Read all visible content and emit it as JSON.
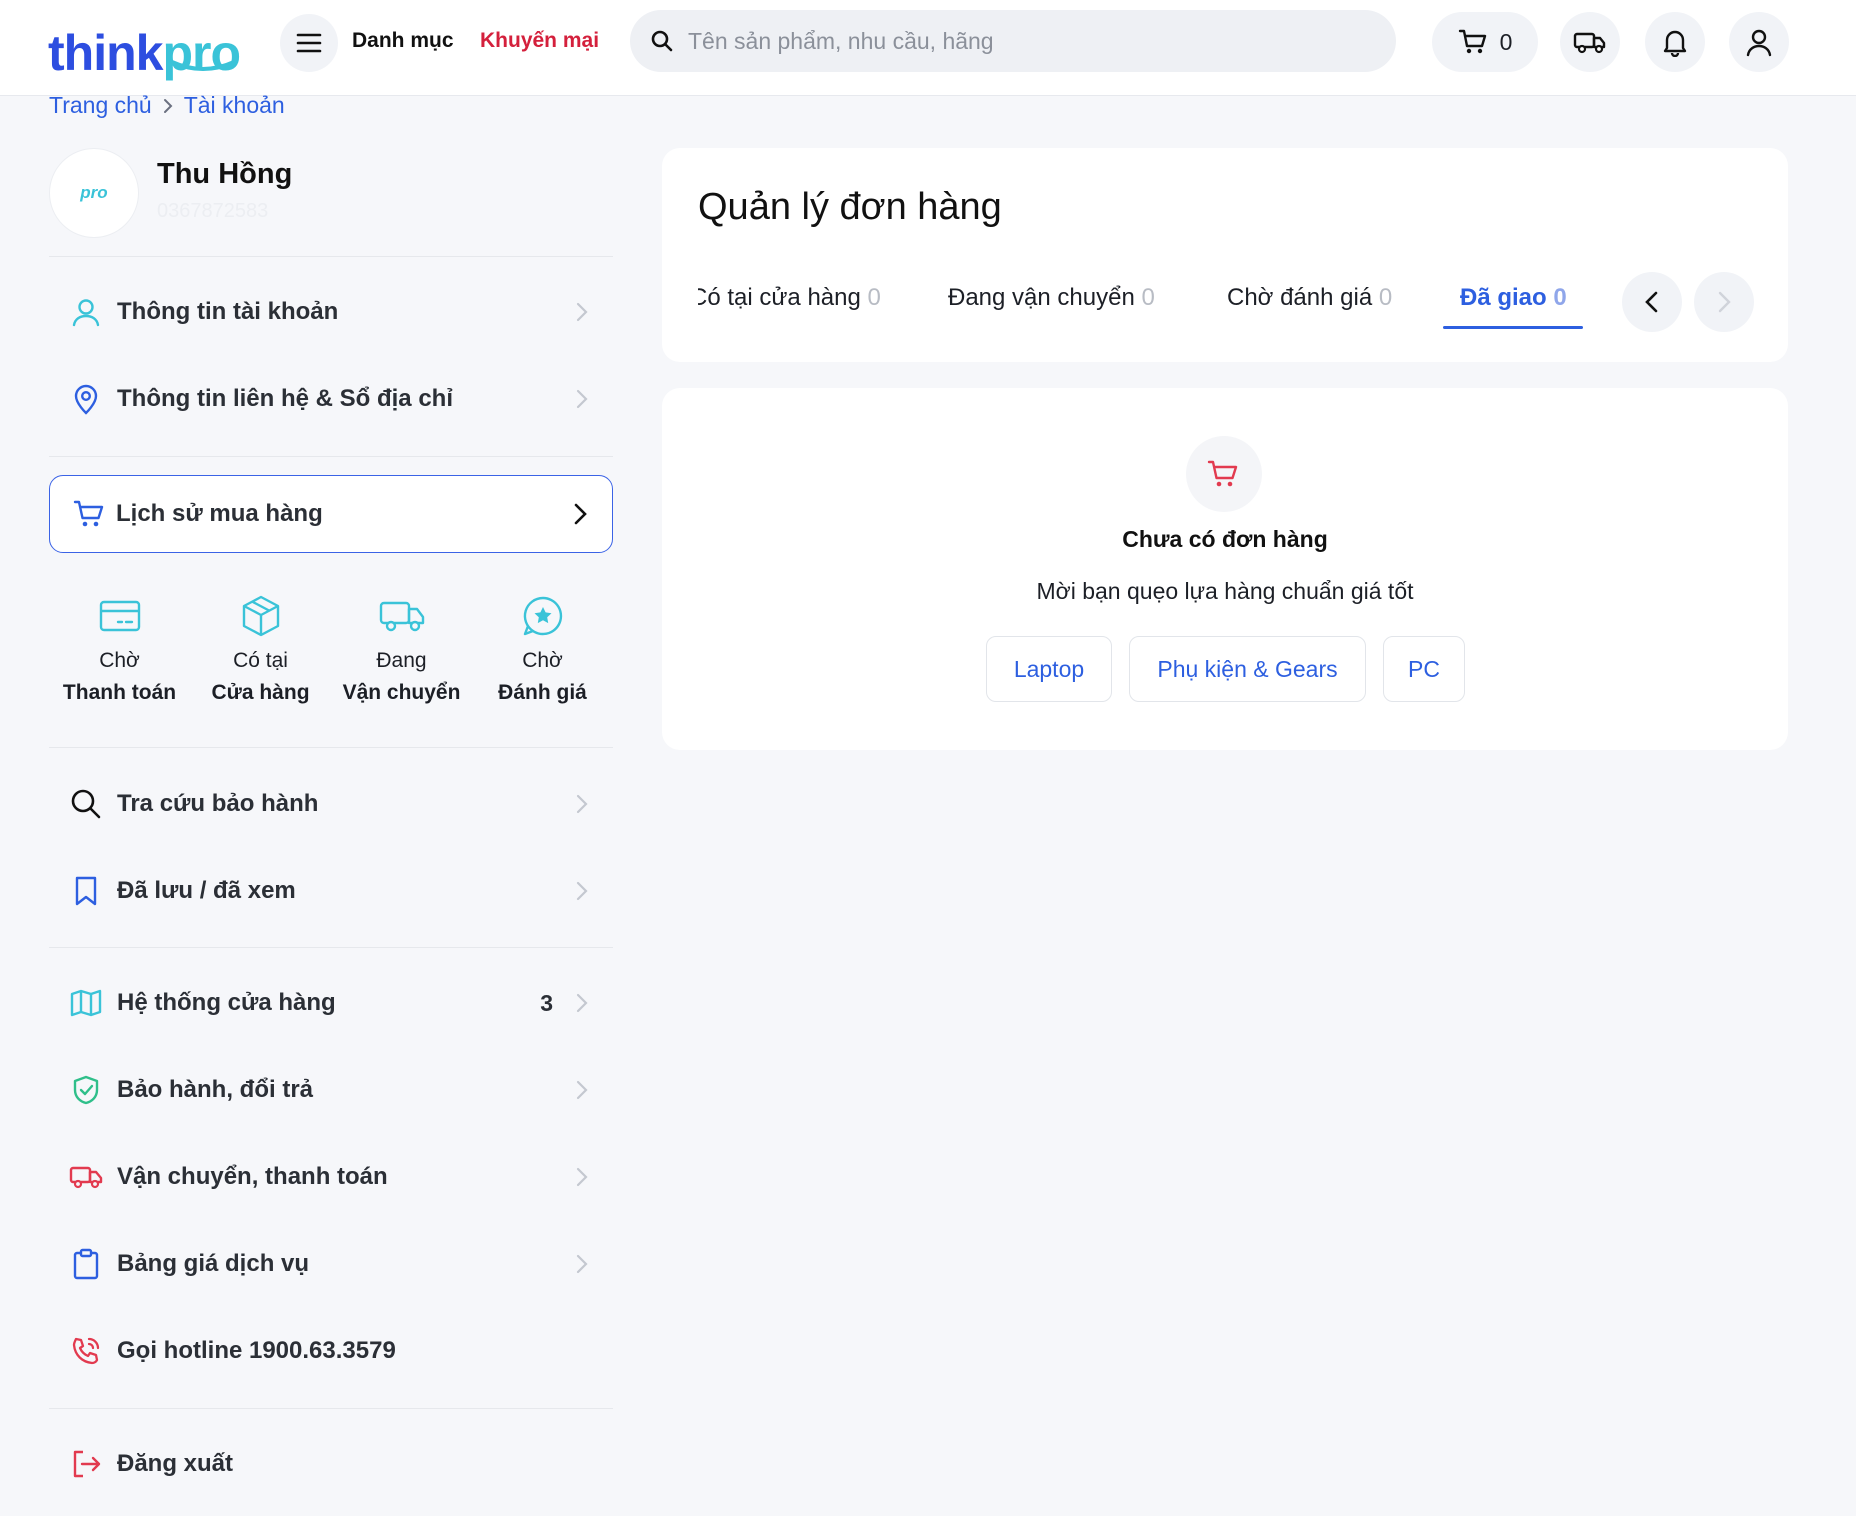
{
  "header": {
    "logo_think": "think",
    "logo_pro": "pro",
    "nav_category": "Danh mục",
    "nav_promo": "Khuyến mại",
    "search_placeholder": "Tên sản phẩm, nhu cầu, hãng",
    "cart_count": "0",
    "icons": [
      "menu-icon",
      "search-icon",
      "cart-icon",
      "truck-icon",
      "bell-icon",
      "user-icon"
    ],
    "colors": {
      "brand_blue": "#2d4ee0",
      "brand_teal": "#3ac3d8",
      "promo_red": "#d4203c"
    }
  },
  "breadcrumb": {
    "home": "Trang chủ",
    "current": "Tài khoản"
  },
  "profile": {
    "name": "Thu Hồng",
    "phone": "0367872583",
    "avatar_text": "pro"
  },
  "sidebar": {
    "account_info": "Thông tin tài khoản",
    "contact_address": "Thông tin liên hệ & Sổ địa chỉ",
    "purchase_history": "Lịch sử mua hàng",
    "status": [
      {
        "top": "Chờ",
        "bottom": "Thanh toán",
        "icon": "card-icon"
      },
      {
        "top": "Có tại",
        "bottom": "Cửa hàng",
        "icon": "box-icon"
      },
      {
        "top": "Đang",
        "bottom": "Vận chuyển",
        "icon": "truck-icon"
      },
      {
        "top": "Chờ",
        "bottom": "Đánh giá",
        "icon": "star-chat-icon"
      }
    ],
    "warranty_lookup": "Tra cứu bảo hành",
    "saved_viewed": "Đã lưu / đã xem",
    "store_system": "Hệ thống cửa hàng",
    "store_count": "3",
    "warranty_return": "Bảo hành, đổi trả",
    "shipping_payment": "Vận chuyển, thanh toán",
    "service_price": "Bảng giá dịch vụ",
    "hotline": "Gọi hotline 1900.63.3579",
    "logout": "Đăng xuất"
  },
  "orders": {
    "title": "Quản lý đơn hàng",
    "tabs": [
      {
        "label": "Có tại cửa hàng",
        "count": "0"
      },
      {
        "label": "Đang vận chuyển",
        "count": "0"
      },
      {
        "label": "Chờ đánh giá",
        "count": "0"
      },
      {
        "label": "Đã giao",
        "count": "0",
        "active": true
      }
    ]
  },
  "empty": {
    "title": "Chưa có đơn hàng",
    "subtitle": "Mời bạn quẹo lựa hàng chuẩn giá tốt",
    "chips": [
      "Laptop",
      "Phụ kiện & Gears",
      "PC"
    ]
  }
}
